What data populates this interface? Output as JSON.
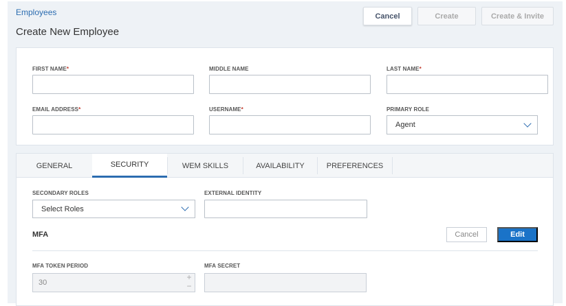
{
  "breadcrumb": "Employees",
  "page_title": "Create New Employee",
  "header_buttons": {
    "cancel": "Cancel",
    "create": "Create",
    "create_invite": "Create & Invite"
  },
  "form": {
    "first_name": {
      "label": "FIRST NAME",
      "required": "*",
      "value": ""
    },
    "middle_name": {
      "label": "MIDDLE NAME",
      "value": ""
    },
    "last_name": {
      "label": "LAST NAME",
      "required": "*",
      "value": ""
    },
    "email": {
      "label": "EMAIL ADDRESS",
      "required": "*",
      "value": ""
    },
    "username": {
      "label": "USERNAME",
      "required": "*",
      "value": ""
    },
    "primary_role": {
      "label": "PRIMARY ROLE",
      "value": "Agent"
    }
  },
  "tabs": [
    {
      "label": "GENERAL"
    },
    {
      "label": "SECURITY"
    },
    {
      "label": "WEM SKILLS"
    },
    {
      "label": "AVAILABILITY"
    },
    {
      "label": "PREFERENCES"
    }
  ],
  "active_tab": "SECURITY",
  "security": {
    "secondary_roles": {
      "label": "SECONDARY ROLES",
      "value": "Select Roles"
    },
    "external_identity": {
      "label": "EXTERNAL IDENTITY",
      "value": ""
    },
    "mfa": {
      "title": "MFA",
      "cancel": "Cancel",
      "edit": "Edit",
      "token_period": {
        "label": "MFA TOKEN PERIOD",
        "value": "30"
      },
      "secret": {
        "label": "MFA SECRET",
        "value": ""
      }
    }
  },
  "colors": {
    "accent": "#1a73c8",
    "link": "#2b6cb0",
    "required": "#c0392b"
  }
}
